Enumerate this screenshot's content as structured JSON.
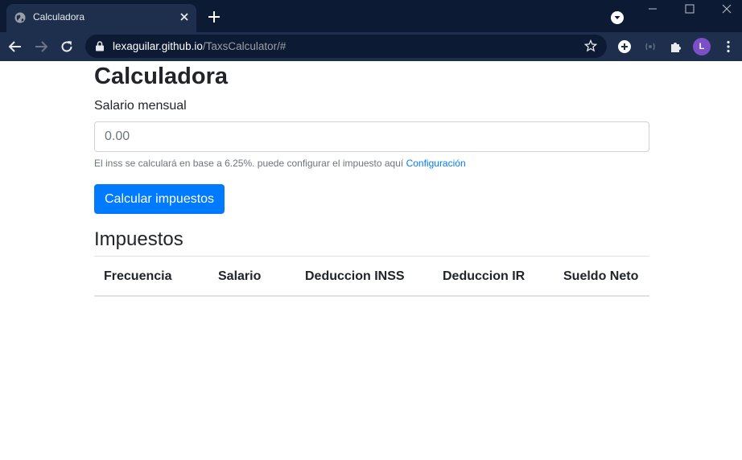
{
  "browser": {
    "tab_title": "Calculadora",
    "url_host": "lexaguilar.github.io",
    "url_path": "/TaxsCalculator/#",
    "profile_initial": "L"
  },
  "page": {
    "title": "Calculadora",
    "salary_label": "Salario mensual",
    "salary_placeholder": "0.00",
    "help_text": "El inss se calculará en base a 6.25%. puede configurar el impuesto aquí",
    "help_link": "Configuración",
    "calc_button": "Calcular impuestos",
    "section_title": "Impuestos",
    "table_headers": [
      "Frecuencia",
      "Salario",
      "Deduccion INSS",
      "Deduccion IR",
      "Sueldo Neto"
    ]
  },
  "colors": {
    "primary": "#007bff",
    "chrome_dark": "#0c1a33",
    "chrome_toolbar": "#1d2f4d",
    "avatar": "#7b4fc8"
  },
  "icons": [
    "globe-icon",
    "close-icon",
    "plus-icon",
    "back-arrow-icon",
    "forward-arrow-icon",
    "reload-icon",
    "lock-icon",
    "star-icon",
    "extension-icon",
    "puzzle-icon",
    "menu-dots-icon"
  ]
}
